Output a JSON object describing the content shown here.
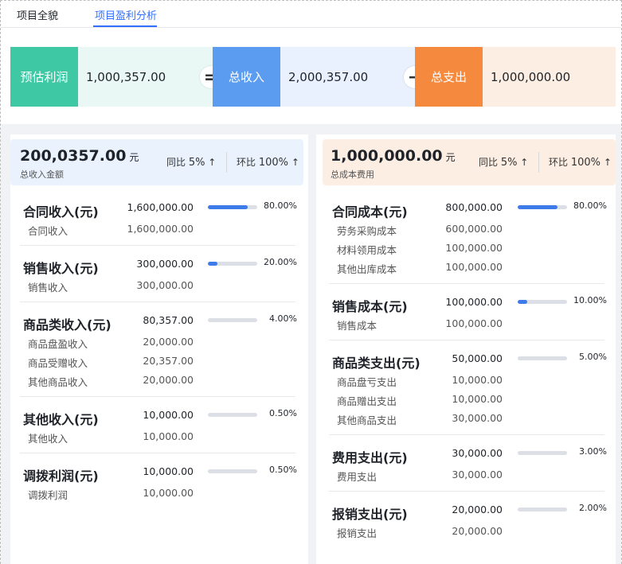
{
  "tabs": [
    "项目全貌",
    "项目盈利分析"
  ],
  "active_tab": 1,
  "summary": {
    "profit_label": "预估利润",
    "profit_value": "1,000,357.00",
    "eq": "=",
    "income_label": "总收入",
    "income_value": "2,000,357.00",
    "minus": "−",
    "expense_label": "总支出",
    "expense_value": "1,000,000.00",
    "colors": {
      "profit": "#3ec9a4",
      "profit_bg": "#e9f8f4",
      "income": "#5b9cf0",
      "income_bg": "#e8f1fd",
      "expense": "#f58a3e",
      "expense_bg": "#fdeee3"
    }
  },
  "income": {
    "amount": "200,0357.00",
    "unit": "元",
    "subtitle": "总收入金额",
    "yoy_label": "同比",
    "yoy_value": "5%",
    "yoy_arrow": "↑",
    "mom_label": "环比",
    "mom_value": "100%",
    "mom_arrow": "↑",
    "groups": [
      {
        "label": "合同收入(元)",
        "value": "1,600,000.00",
        "pct": "80.00%",
        "ratio": 0.8,
        "items": [
          {
            "label": "合同收入",
            "value": "1,600,000.00"
          }
        ]
      },
      {
        "label": "销售收入(元)",
        "value": "300,000.00",
        "pct": "20.00%",
        "ratio": 0.2,
        "items": [
          {
            "label": "销售收入",
            "value": "300,000.00"
          }
        ]
      },
      {
        "label": "商品类收入(元)",
        "value": "80,357.00",
        "pct": "4.00%",
        "ratio": 0.0,
        "items": [
          {
            "label": "商品盘盈收入",
            "value": "20,000.00"
          },
          {
            "label": "商品受赠收入",
            "value": "20,357.00"
          },
          {
            "label": "其他商品收入",
            "value": "20,000.00"
          }
        ]
      },
      {
        "label": "其他收入(元)",
        "value": "10,000.00",
        "pct": "0.50%",
        "ratio": 0.0,
        "items": [
          {
            "label": "其他收入",
            "value": "10,000.00"
          }
        ]
      },
      {
        "label": "调拨利润(元)",
        "value": "10,000.00",
        "pct": "0.50%",
        "ratio": 0.0,
        "items": [
          {
            "label": "调拨利润",
            "value": "10,000.00"
          }
        ]
      }
    ]
  },
  "expense": {
    "amount": "1,000,000.00",
    "unit": "元",
    "subtitle": "总成本费用",
    "yoy_label": "同比",
    "yoy_value": "5%",
    "yoy_arrow": "↑",
    "mom_label": "环比",
    "mom_value": "100%",
    "mom_arrow": "↑",
    "groups": [
      {
        "label": "合同成本(元)",
        "value": "800,000.00",
        "pct": "80.00%",
        "ratio": 0.8,
        "items": [
          {
            "label": "劳务采购成本",
            "value": "600,000.00"
          },
          {
            "label": "材料领用成本",
            "value": "100,000.00"
          },
          {
            "label": "其他出库成本",
            "value": "100,000.00"
          }
        ]
      },
      {
        "label": "销售成本(元)",
        "value": "100,000.00",
        "pct": "10.00%",
        "ratio": 0.2,
        "items": [
          {
            "label": "销售成本",
            "value": "100,000.00"
          }
        ]
      },
      {
        "label": "商品类支出(元)",
        "value": "50,000.00",
        "pct": "5.00%",
        "ratio": 0.0,
        "items": [
          {
            "label": "商品盘亏支出",
            "value": "10,000.00"
          },
          {
            "label": "商品赠出支出",
            "value": "10,000.00"
          },
          {
            "label": "其他商品支出",
            "value": "30,000.00"
          }
        ]
      },
      {
        "label": "费用支出(元)",
        "value": "30,000.00",
        "pct": "3.00%",
        "ratio": 0.0,
        "items": [
          {
            "label": "费用支出",
            "value": "30,000.00"
          }
        ]
      },
      {
        "label": "报销支出(元)",
        "value": "20,000.00",
        "pct": "2.00%",
        "ratio": 0.0,
        "items": [
          {
            "label": "报销支出",
            "value": "20,000.00"
          }
        ]
      }
    ]
  }
}
